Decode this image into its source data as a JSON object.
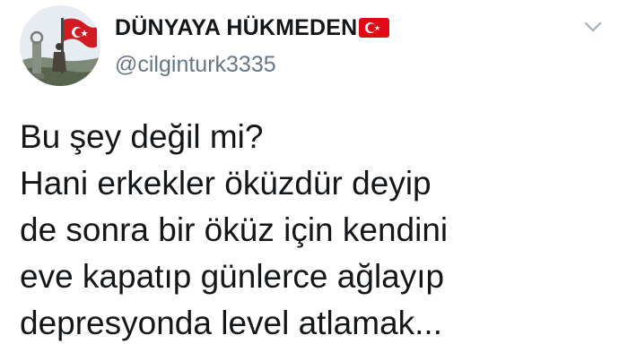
{
  "tweet": {
    "author": {
      "display_name": "DÜNYAYA HÜKMEDEN",
      "handle": "@cilginturk3335",
      "flag_icon": "turkey-flag-icon"
    },
    "menu_icon": "chevron-down-icon",
    "text_lines": [
      "Bu şey değil mi?",
      "Hani erkekler öküzdür deyip",
      "de sonra bir öküz için kendini",
      "eve kapatıp günlerce ağlayıp",
      "depresyonda level atlamak..."
    ]
  },
  "colors": {
    "name": "#14171a",
    "handle": "#657786",
    "flag_red": "#e30a17",
    "chevron": "#aab8c2"
  }
}
